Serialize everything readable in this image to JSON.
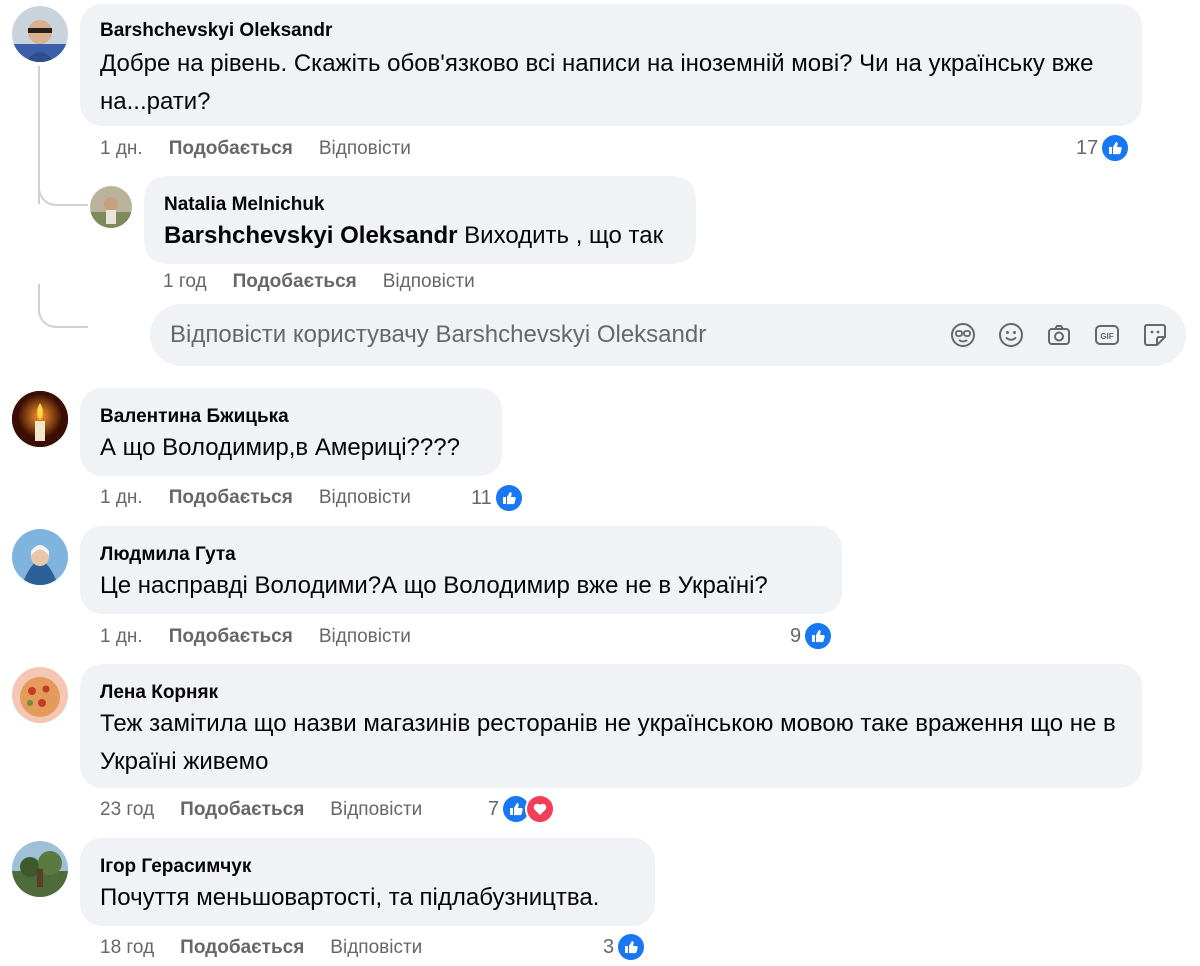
{
  "comments": [
    {
      "author": "Barshchevskyi Oleksandr",
      "text": "Добре на рівень. Скажіть обов'язково всі написи на іноземній мові? Чи на українську вже на...рати?",
      "time": "1 дн.",
      "like_label": "Подобається",
      "reply_label": "Відповісти",
      "reaction_count": "17",
      "reactions": [
        "like-icon"
      ]
    },
    {
      "author": "Natalia Melnichuk",
      "mention": "Barshchevskyi Oleksandr",
      "text": " Виходить , що так",
      "time": "1 год",
      "like_label": "Подобається",
      "reply_label": "Відповісти"
    },
    {
      "author": "Валентина Бжицька",
      "text": "А що Володимир,в Америці????",
      "time": "1 дн.",
      "like_label": "Подобається",
      "reply_label": "Відповісти",
      "reaction_count": "11",
      "reactions": [
        "like-icon"
      ]
    },
    {
      "author": "Людмила Гута",
      "text": "Це насправді Володими?А що Володимир вже не в Україні?",
      "time": "1 дн.",
      "like_label": "Подобається",
      "reply_label": "Відповісти",
      "reaction_count": "9",
      "reactions": [
        "like-icon"
      ]
    },
    {
      "author": "Лена Корняк",
      "text": "Теж замітила що назви магазинів ресторанів не українською мовою таке враження що не в Україні живемо",
      "time": "23 год",
      "like_label": "Подобається",
      "reply_label": "Відповісти",
      "reaction_count": "7",
      "reactions": [
        "like-icon",
        "love-icon"
      ]
    },
    {
      "author": "Ігор Герасимчук",
      "text": "Почуття меньшовартості, та підлабузництва.",
      "time": "18 год",
      "like_label": "Подобається",
      "reply_label": "Відповісти",
      "reaction_count": "3",
      "reactions": [
        "like-icon"
      ]
    }
  ],
  "reply_input": {
    "placeholder": "Відповісти користувачу Barshchevskyi Oleksandr",
    "icons": [
      "avatar-sticker-icon",
      "emoji-icon",
      "camera-icon",
      "gif-icon",
      "sticker-icon"
    ]
  },
  "colors": {
    "bubble": "#f0f2f5",
    "like_blue": "#1877f2",
    "love_red": "#f33e58",
    "meta_gray": "#65676b"
  }
}
